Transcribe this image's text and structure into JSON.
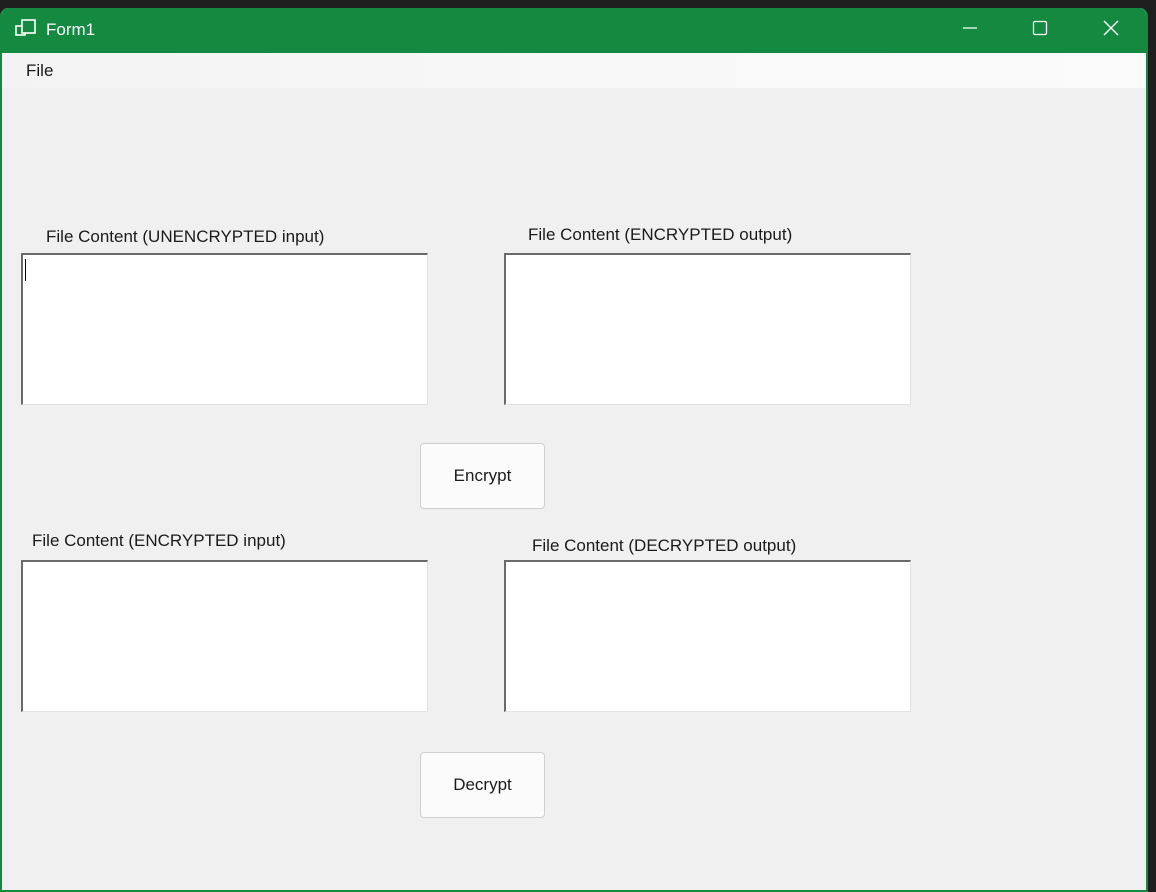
{
  "window": {
    "title": "Form1",
    "accent_color": "#138a3f",
    "controls": {
      "minimize_icon": "minimize-icon",
      "maximize_icon": "maximize-icon",
      "close_icon": "close-icon"
    }
  },
  "menu": {
    "items": [
      {
        "label": "File"
      }
    ]
  },
  "encrypt_section": {
    "input_label": "File Content (UNENCRYPTED input)",
    "input_value": "",
    "output_label": "File Content (ENCRYPTED output)",
    "output_value": "",
    "button_label": "Encrypt"
  },
  "decrypt_section": {
    "input_label": "File Content (ENCRYPTED input)",
    "input_value": "",
    "output_label": "File Content (DECRYPTED output)",
    "output_value": "",
    "button_label": "Decrypt"
  }
}
